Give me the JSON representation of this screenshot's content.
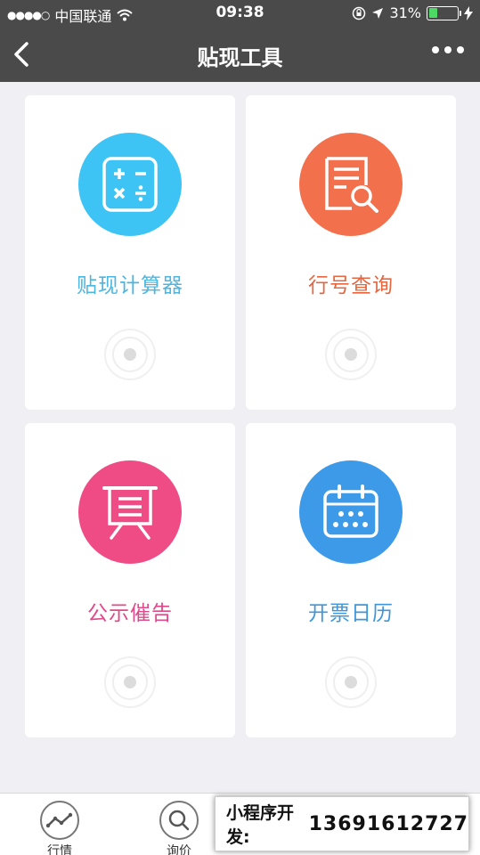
{
  "status": {
    "carrier": "中国联通",
    "time": "09:38",
    "battery": "31%",
    "battery_level": 0.31
  },
  "nav": {
    "title": "贴现工具"
  },
  "tools": [
    {
      "label": "贴现计算器",
      "icon": "calculator-icon",
      "color": "#3ec3f5",
      "text_color": "#4bb7e0"
    },
    {
      "label": "行号查询",
      "icon": "document-search-icon",
      "color": "#f3704c",
      "text_color": "#e5663f"
    },
    {
      "label": "公示催告",
      "icon": "notice-board-icon",
      "color": "#ef4c86",
      "text_color": "#e0498a"
    },
    {
      "label": "开票日历",
      "icon": "calendar-icon",
      "color": "#3d9ae8",
      "text_color": "#3f96d8"
    }
  ],
  "tabbar": {
    "tabs": [
      {
        "label": "行情",
        "icon": "trend-icon"
      },
      {
        "label": "询价",
        "icon": "search-icon"
      }
    ]
  },
  "promo": {
    "label": "小程序开发:",
    "phone": "13691612727"
  }
}
